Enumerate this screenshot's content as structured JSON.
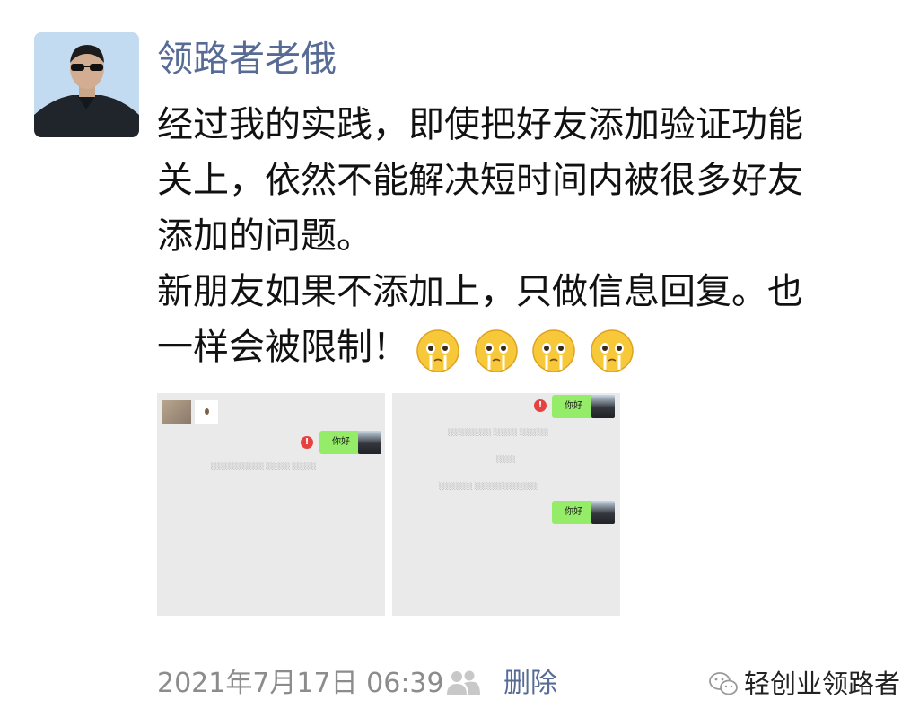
{
  "post": {
    "author": "领路者老俄",
    "lines": [
      "经过我的实践，即使把好友添加验证功能",
      "关上，依然不能解决短时间内被很多好友",
      "添加的问题。",
      "新朋友如果不添加上，只做信息回复。也",
      "一样会被限制！"
    ],
    "emoji": [
      "tearful-face-emoji",
      "tearful-face-emoji",
      "tearful-face-emoji",
      "tearful-face-emoji"
    ]
  },
  "images": {
    "shot_1": {
      "bubble": "你好",
      "warning_icon": "red-exclamation-icon"
    },
    "shot_2": {
      "bubble_top": "你好",
      "bubble_bottom": "你好",
      "warning_icon": "red-exclamation-icon"
    }
  },
  "footer": {
    "timestamp": "2021年7月17日 06:39",
    "visibility_icon": "two-people-icon",
    "delete_label": "删除"
  },
  "watermark": {
    "icon": "wechat-icon",
    "text": "轻创业领路者"
  },
  "colors": {
    "link": "#576b95",
    "bubble": "#95ec69",
    "warning": "#e64340",
    "meta": "#8c8c8c"
  }
}
